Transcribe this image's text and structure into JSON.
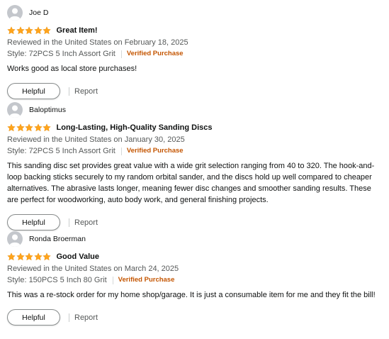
{
  "colors": {
    "star": "#ffa41c",
    "verified": "#c45500",
    "meta_text": "#565959",
    "avatar_bg": "#c4c7cc"
  },
  "reviews": [
    {
      "author": "Joe D",
      "rating": 5,
      "title": "Great Item!",
      "date_line": "Reviewed in the United States on February 18, 2025",
      "style": "Style: 72PCS 5 Inch Assort Grit",
      "verified": "Verified Purchase",
      "body": "Works good as local store purchases!",
      "helpful_label": "Helpful",
      "report_label": "Report"
    },
    {
      "author": "Baloptimus",
      "rating": 5,
      "title": "Long-Lasting, High-Quality Sanding Discs",
      "date_line": "Reviewed in the United States on January 30, 2025",
      "style": "Style: 72PCS 5 Inch Assort Grit",
      "verified": "Verified Purchase",
      "body": "This sanding disc set provides great value with a wide grit selection ranging from 40 to 320. The hook-and-loop backing sticks securely to my random orbital sander, and the discs hold up well compared to cheaper alternatives. The abrasive lasts longer, meaning fewer disc changes and smoother sanding results. These are perfect for woodworking, auto body work, and general finishing projects.",
      "helpful_label": "Helpful",
      "report_label": "Report"
    },
    {
      "author": "Ronda Broerman",
      "rating": 5,
      "title": "Good Value",
      "date_line": "Reviewed in the United States on March 24, 2025",
      "style": "Style: 150PCS 5 Inch 80 Grit",
      "verified": "Verified Purchase",
      "body": "This was a re-stock order for my home shop/garage. It is just a consumable item for me and they fit the bill!",
      "helpful_label": "Helpful",
      "report_label": "Report"
    }
  ]
}
